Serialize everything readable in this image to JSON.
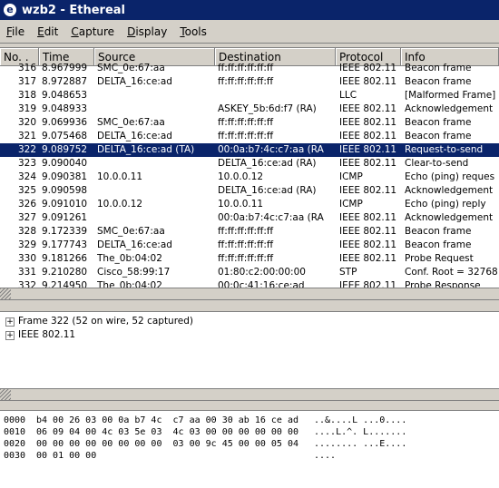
{
  "window": {
    "title": "wzb2 - Ethereal",
    "icon": "ethereal-logo-icon"
  },
  "menu": [
    {
      "u": "F",
      "rest": "ile"
    },
    {
      "u": "E",
      "rest": "dit"
    },
    {
      "u": "C",
      "rest": "apture"
    },
    {
      "u": "D",
      "rest": "isplay"
    },
    {
      "u": "T",
      "rest": "ools"
    }
  ],
  "columns": {
    "no": "No. .",
    "time": "Time",
    "source": "Source",
    "destination": "Destination",
    "protocol": "Protocol",
    "info": "Info"
  },
  "rows": [
    {
      "no": "316",
      "time": "8.967999",
      "src": "SMC_0e:67:aa",
      "dst": "ff:ff:ff:ff:ff:ff",
      "proto": "IEEE 802.11",
      "info": "Beacon frame"
    },
    {
      "no": "317",
      "time": "8.972887",
      "src": "DELTA_16:ce:ad",
      "dst": "ff:ff:ff:ff:ff:ff",
      "proto": "IEEE 802.11",
      "info": "Beacon frame"
    },
    {
      "no": "318",
      "time": "9.048653",
      "src": "",
      "dst": "",
      "proto": "LLC",
      "info": "[Malformed Frame]"
    },
    {
      "no": "319",
      "time": "9.048933",
      "src": "",
      "dst": "ASKEY_5b:6d:f7 (RA)",
      "proto": "IEEE 802.11",
      "info": "Acknowledgement"
    },
    {
      "no": "320",
      "time": "9.069936",
      "src": "SMC_0e:67:aa",
      "dst": "ff:ff:ff:ff:ff:ff",
      "proto": "IEEE 802.11",
      "info": "Beacon frame"
    },
    {
      "no": "321",
      "time": "9.075468",
      "src": "DELTA_16:ce:ad",
      "dst": "ff:ff:ff:ff:ff:ff",
      "proto": "IEEE 802.11",
      "info": "Beacon frame"
    },
    {
      "no": "322",
      "time": "9.089752",
      "src": "DELTA_16:ce:ad (TA)",
      "dst": "00:0a:b7:4c:c7:aa (RA",
      "proto": "IEEE 802.11",
      "info": "Request-to-send",
      "selected": true
    },
    {
      "no": "323",
      "time": "9.090040",
      "src": "",
      "dst": "DELTA_16:ce:ad (RA)",
      "proto": "IEEE 802.11",
      "info": "Clear-to-send"
    },
    {
      "no": "324",
      "time": "9.090381",
      "src": "10.0.0.11",
      "dst": "10.0.0.12",
      "proto": "ICMP",
      "info": "Echo (ping) reques"
    },
    {
      "no": "325",
      "time": "9.090598",
      "src": "",
      "dst": "DELTA_16:ce:ad (RA)",
      "proto": "IEEE 802.11",
      "info": "Acknowledgement"
    },
    {
      "no": "326",
      "time": "9.091010",
      "src": "10.0.0.12",
      "dst": "10.0.0.11",
      "proto": "ICMP",
      "info": "Echo (ping) reply"
    },
    {
      "no": "327",
      "time": "9.091261",
      "src": "",
      "dst": "00:0a:b7:4c:c7:aa (RA",
      "proto": "IEEE 802.11",
      "info": "Acknowledgement"
    },
    {
      "no": "328",
      "time": "9.172339",
      "src": "SMC_0e:67:aa",
      "dst": "ff:ff:ff:ff:ff:ff",
      "proto": "IEEE 802.11",
      "info": "Beacon frame"
    },
    {
      "no": "329",
      "time": "9.177743",
      "src": "DELTA_16:ce:ad",
      "dst": "ff:ff:ff:ff:ff:ff",
      "proto": "IEEE 802.11",
      "info": "Beacon frame"
    },
    {
      "no": "330",
      "time": "9.181266",
      "src": "The_0b:04:02",
      "dst": "ff:ff:ff:ff:ff:ff",
      "proto": "IEEE 802.11",
      "info": "Probe Request"
    },
    {
      "no": "331",
      "time": "9.210280",
      "src": "Cisco_58:99:17",
      "dst": "01:80:c2:00:00:00",
      "proto": "STP",
      "info": "Conf. Root = 32768"
    },
    {
      "no": "332",
      "time": "9.214950",
      "src": "The_0b:04:02",
      "dst": "00:0c:41:16:ce:ad",
      "proto": "IEEE 802.11",
      "info": "Probe Response"
    }
  ],
  "details": [
    "Frame 322 (52 on wire, 52 captured)",
    "IEEE 802.11"
  ],
  "hex": [
    {
      "off": "0000",
      "hex": "b4 00 26 03 00 0a b7 4c  c7 aa 00 30 ab 16 ce ad",
      "ascii": "..&....L ...0...."
    },
    {
      "off": "0010",
      "hex": "06 09 04 00 4c 03 5e 03  4c 03 00 00 00 00 00 00",
      "ascii": "....L.^. L......."
    },
    {
      "off": "0020",
      "hex": "00 00 00 00 00 00 00 00  03 00 9c 45 00 00 05 04",
      "ascii": "........ ...E...."
    },
    {
      "off": "0030",
      "hex": "00 01 00 00",
      "ascii": "...."
    }
  ],
  "colors": {
    "titlebar": "#0a246a",
    "selection": "#0a246a",
    "chrome": "#d4d0c8"
  }
}
